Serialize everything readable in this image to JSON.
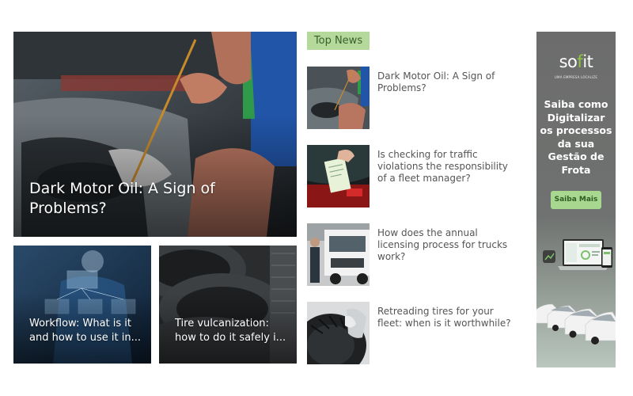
{
  "featured": {
    "title": "Dark Motor Oil: A Sign of Problems?"
  },
  "sub_cards": [
    {
      "line1": "Workflow: What is it",
      "line2": "and how to use it in..."
    },
    {
      "line1": "Tire vulcanization:",
      "line2": "how to do it safely i..."
    }
  ],
  "top_news": {
    "label": "Top News",
    "items": [
      {
        "title": "Dark Motor Oil: A Sign of Problems?"
      },
      {
        "title": "Is checking for traffic violations the responsibility of a fleet manager?"
      },
      {
        "title": "How does the annual licensing process for trucks work?"
      },
      {
        "title": "Retreading tires for your fleet: when is it worthwhile?"
      }
    ]
  },
  "ad": {
    "logo_main": "so",
    "logo_accent": "f",
    "logo_end": "it",
    "tagline": "UMA EMPRESA LOCALIZE",
    "headline": "Saiba como Digitalizar os processos da sua Gestão de Frota",
    "cta": "Saiba Mais"
  },
  "colors": {
    "accent_green": "#b5d89b",
    "ad_button": "#a8d88f",
    "logo_green": "#8cc63f"
  }
}
